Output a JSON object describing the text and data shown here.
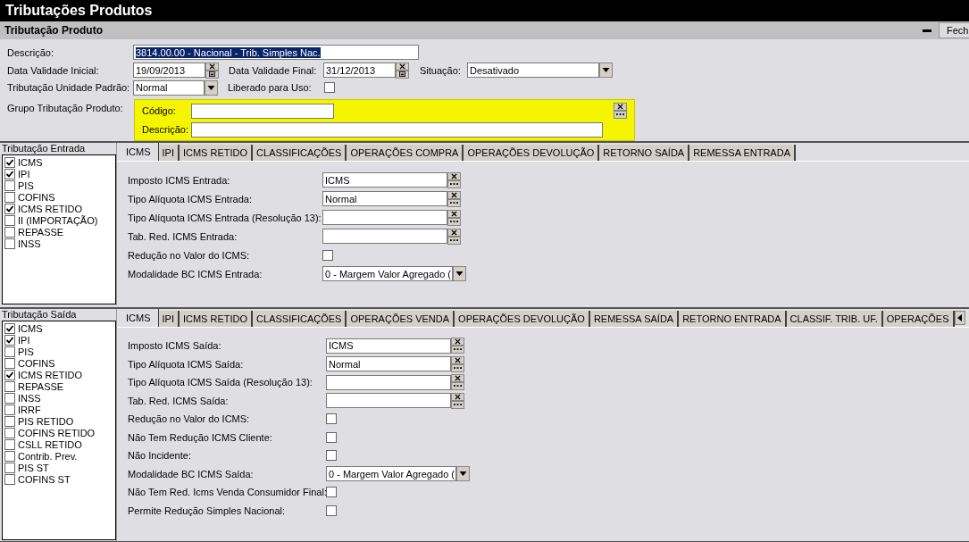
{
  "window": {
    "title": "Tributações Produtos"
  },
  "section": {
    "title": "Tributação Produto",
    "close_button": "Fech"
  },
  "form": {
    "descricao": {
      "label": "Descrição:",
      "value": "3814.00.00 - Nacional - Trib. Simples Nac.",
      "selected": true
    },
    "data_inicial": {
      "label": "Data Validade Inicial:",
      "value": "19/09/2013"
    },
    "data_final": {
      "label": "Data Validade Final:",
      "value": "31/12/2013"
    },
    "situacao": {
      "label": "Situação:",
      "value": "Desativado"
    },
    "unidade": {
      "label": "Tributação Unidade Padrão:",
      "value": "Normal"
    },
    "liberado": {
      "label": "Liberado para Uso:",
      "checked": false
    },
    "grupo": {
      "label": "Grupo Tributação Produto:",
      "highlighted": true,
      "codigo_label": "Código:",
      "descricao_label": "Descrição:"
    }
  },
  "panels": [
    {
      "caption": "Tributação Entrada",
      "tabs_scroll": false,
      "taxes": [
        {
          "label": "ICMS",
          "checked": true
        },
        {
          "label": "IPI",
          "checked": true
        },
        {
          "label": "PIS",
          "checked": false
        },
        {
          "label": "COFINS",
          "checked": false
        },
        {
          "label": "ICMS RETIDO",
          "checked": true
        },
        {
          "label": "II (IMPORTAÇÃO)",
          "checked": false
        },
        {
          "label": "REPASSE",
          "checked": false
        },
        {
          "label": "INSS",
          "checked": false
        }
      ],
      "tabs": [
        {
          "label": "ICMS",
          "selected": true
        },
        {
          "label": "IPI",
          "selected": false
        },
        {
          "label": "ICMS RETIDO",
          "selected": false
        },
        {
          "label": "CLASSIFICAÇÕES",
          "selected": false
        },
        {
          "label": "OPERAÇÕES COMPRA",
          "selected": false
        },
        {
          "label": "OPERAÇÕES DEVOLUÇÃO",
          "selected": false
        },
        {
          "label": "RETORNO SAÍDA",
          "selected": false
        },
        {
          "label": "REMESSA ENTRADA",
          "selected": false
        }
      ],
      "fields": [
        {
          "kind": "lookup",
          "label": "Imposto ICMS Entrada:",
          "value": "ICMS"
        },
        {
          "kind": "lookup",
          "label": "Tipo Alíquota ICMS Entrada:",
          "value": "Normal"
        },
        {
          "kind": "lookup",
          "label": "Tipo Alíquota ICMS Entrada (Resolução 13):"
        },
        {
          "kind": "lookup",
          "label": "Tab. Red. ICMS Entrada:"
        },
        {
          "kind": "checkbox",
          "label": "Redução no Valor do ICMS:",
          "checked": false
        },
        {
          "kind": "select",
          "label": "Modalidade BC ICMS Entrada:",
          "value": "0 - Margem Valor Agregado ("
        }
      ]
    },
    {
      "caption": "Tributação Saída",
      "tabs_scroll": true,
      "taxes": [
        {
          "label": "ICMS",
          "checked": true
        },
        {
          "label": "IPI",
          "checked": true
        },
        {
          "label": "PIS",
          "checked": false
        },
        {
          "label": "COFINS",
          "checked": false
        },
        {
          "label": "ICMS RETIDO",
          "checked": true
        },
        {
          "label": "REPASSE",
          "checked": false
        },
        {
          "label": "INSS",
          "checked": false
        },
        {
          "label": "IRRF",
          "checked": false
        },
        {
          "label": "PIS RETIDO",
          "checked": false
        },
        {
          "label": "COFINS RETIDO",
          "checked": false
        },
        {
          "label": "CSLL RETIDO",
          "checked": false
        },
        {
          "label": "Contrib. Prev.",
          "checked": false
        },
        {
          "label": "PIS ST",
          "checked": false
        },
        {
          "label": "COFINS ST",
          "checked": false
        }
      ],
      "tabs": [
        {
          "label": "ICMS",
          "selected": true
        },
        {
          "label": "IPI",
          "selected": false
        },
        {
          "label": "ICMS RETIDO",
          "selected": false
        },
        {
          "label": "CLASSIFICAÇÕES",
          "selected": false
        },
        {
          "label": "OPERAÇÕES VENDA",
          "selected": false
        },
        {
          "label": "OPERAÇÕES DEVOLUÇÃO",
          "selected": false
        },
        {
          "label": "REMESSA SAÍDA",
          "selected": false
        },
        {
          "label": "RETORNO ENTRADA",
          "selected": false
        },
        {
          "label": "CLASSIF. TRIB. UF.",
          "selected": false
        },
        {
          "label": "OPERAÇÕES",
          "selected": false
        }
      ],
      "fields": [
        {
          "kind": "lookup",
          "label": "Imposto ICMS Saída:",
          "value": "ICMS"
        },
        {
          "kind": "lookup",
          "label": "Tipo Alíquota ICMS Saída:",
          "value": "Normal"
        },
        {
          "kind": "lookup",
          "label": "Tipo Alíquota ICMS Saída (Resolução 13):"
        },
        {
          "kind": "lookup",
          "label": "Tab. Red. ICMS Saída:"
        },
        {
          "kind": "checkbox",
          "label": "Redução no Valor do ICMS:",
          "checked": false
        },
        {
          "kind": "checkbox",
          "label": "Não Tem Redução ICMS Cliente:",
          "checked": false
        },
        {
          "kind": "checkbox",
          "label": "Não Incidente:",
          "checked": false
        },
        {
          "kind": "select",
          "label": "Modalidade BC ICMS Saída:",
          "value": "0 - Margem Valor Agregado ("
        },
        {
          "kind": "checkbox",
          "label": "Não Tem Red. Icms Venda Consumidor Final:",
          "checked": false
        },
        {
          "kind": "checkbox",
          "label": "Permite Redução Simples Nacional:",
          "checked": false
        }
      ]
    }
  ]
}
